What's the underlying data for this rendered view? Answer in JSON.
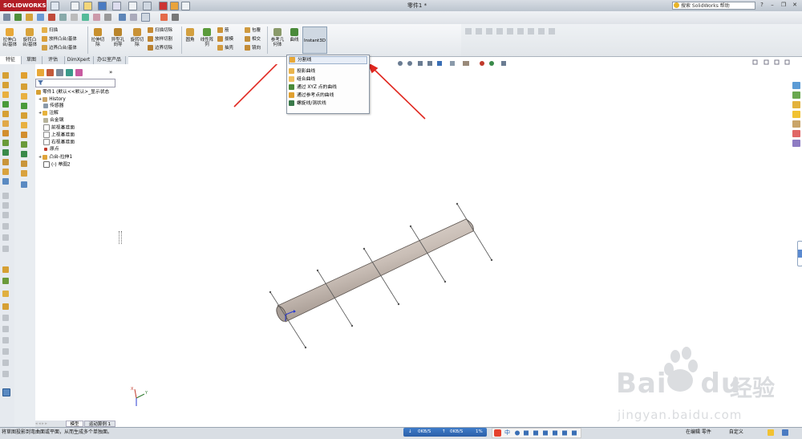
{
  "window": {
    "app": "SOLIDWORKS",
    "title": "零件1 *"
  },
  "help_search": {
    "placeholder": "搜索 SolidWorks 帮助"
  },
  "command_manager": {
    "extrude_boss": "拉伸凸\n台/基体",
    "revolve_boss": "旋转凸\n台/基体",
    "sweep": "扫描",
    "loft": "放样凸台/基体",
    "boundary_boss": "边界凸台/基体",
    "extrude_cut": "拉伸切\n除",
    "hole_wizard": "异型孔\n向导",
    "revolve_cut": "旋转切\n除",
    "sweep_cut": "扫描切除",
    "loft_cut": "放样切割",
    "boundary_cut": "边界切除",
    "fillet": "圆角",
    "linear_pattern": "线性阵\n列",
    "rib": "筋",
    "draft": "拔模",
    "shell": "抽壳",
    "wrap": "包覆",
    "intersect": "相交",
    "mirror": "镜向",
    "ref_geometry": "参考几\n何体",
    "curves": "曲线",
    "instant3d": "Instant3D"
  },
  "tabs": [
    "特征",
    "草图",
    "评估",
    "DimXpert",
    "办公室产品"
  ],
  "feature_tree": {
    "root": "零件1 (默认<<默认>_显示状态",
    "items": [
      "History",
      "传感器",
      "注解",
      "合金钢",
      "前视基准面",
      "上视基准面",
      "右视基准面",
      "原点",
      "凸台-拉伸1",
      "(-) 草图2"
    ]
  },
  "curves_menu": {
    "items": [
      "分割线",
      "投影曲线",
      "组合曲线",
      "通过 XYZ 点的曲线",
      "通过参考点的曲线",
      "螺旋线/涡状线"
    ],
    "highlighted_index": 0
  },
  "bottom_tabs": [
    "模型",
    "运动算例 1"
  ],
  "status": {
    "left_text": "将草图投影到弯曲面或平面，从而生成多个单独面。",
    "net_down": "0KB/S",
    "net_up": "0KB/S",
    "net_pct": "1%",
    "ime": "中",
    "editing": "在编辑 零件",
    "custom": "自定义"
  },
  "watermark": {
    "brand": "Bai",
    "brand2": "du",
    "cn": "经验",
    "url": "jingyan.baidu.com"
  },
  "colors": {
    "accent_red": "#b21e26",
    "arrow_red": "#e0271f",
    "highlight": "#e8eef7"
  }
}
